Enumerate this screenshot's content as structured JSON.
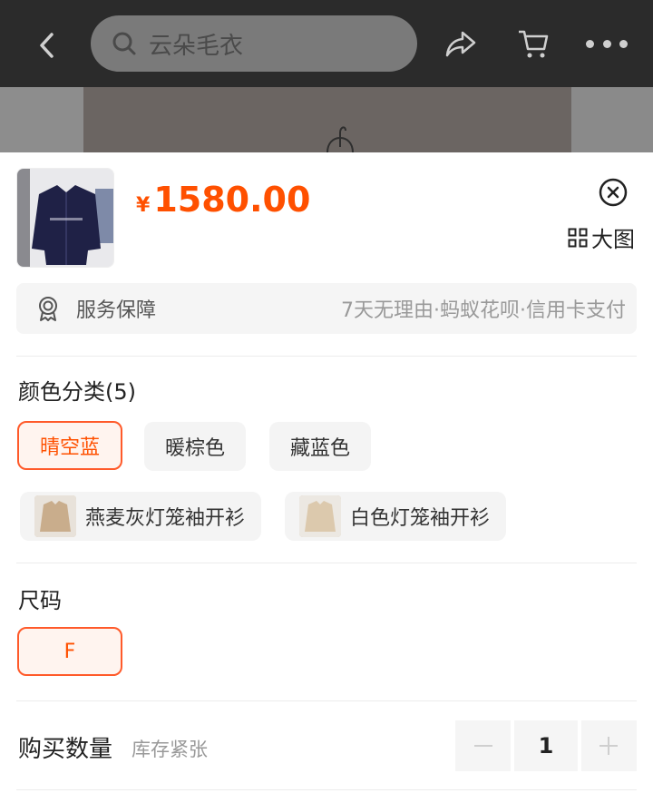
{
  "topbar": {
    "search_text": "云朵毛衣"
  },
  "product": {
    "currency_symbol": "¥",
    "price": "1580.00",
    "price_color": "#ff5000"
  },
  "service": {
    "label": "服务保障",
    "detail": "7天无理由·蚂蚁花呗·信用卡支付"
  },
  "color_section": {
    "title": "颜色分类(5)",
    "view_large_label": "大图",
    "options": [
      {
        "label": "晴空蓝",
        "selected": true
      },
      {
        "label": "暖棕色",
        "selected": false
      },
      {
        "label": "藏蓝色",
        "selected": false
      },
      {
        "label": "燕麦灰灯笼袖开衫",
        "selected": false
      },
      {
        "label": "白色灯笼袖开衫",
        "selected": false
      }
    ]
  },
  "size_section": {
    "title": "尺码",
    "options": [
      {
        "label": "F",
        "selected": true
      }
    ]
  },
  "quantity": {
    "label": "购买数量",
    "stock_note": "库存紧张",
    "value": "1"
  },
  "colors": {
    "accent": "#ff5000",
    "selected_border": "#ff5a2a",
    "topbar_bg": "#2b2b2b"
  }
}
